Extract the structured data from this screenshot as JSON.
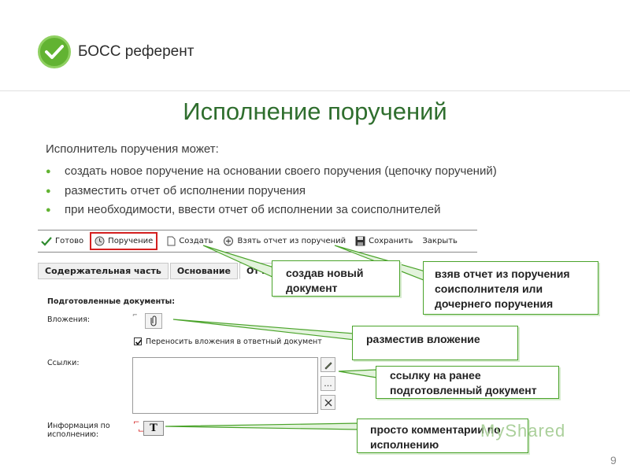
{
  "brand": {
    "name": "БОСС референт",
    "accent": "#62b332"
  },
  "slide": {
    "title": "Исполнение поручений",
    "intro": "Исполнитель поручения может:",
    "bullets": [
      "создать новое поручение на основании своего поручения (цепочку поручений)",
      "разместить отчет об исполнении поручения",
      "при необходимости, ввести отчет об исполнении за соисполнителей"
    ],
    "page_number": "9"
  },
  "toolbar": {
    "done": "Готово",
    "assignment": "Поручение",
    "create": "Создать",
    "take_report": "Взять отчет из поручений",
    "save": "Сохранить",
    "close": "Закрыть"
  },
  "tabs": [
    "Содержательная часть",
    "Основание",
    "Отче"
  ],
  "form": {
    "prepared_docs": "Подготовленные документы:",
    "attachments": "Вложения:",
    "transfer_checkbox": "Переносить вложения в ответный документ",
    "links": "Ссылки:",
    "exec_info_line1": "Информация по",
    "exec_info_line2": "исполнению:",
    "text_button": "T",
    "dots_button": "..."
  },
  "callouts": {
    "create_new": "создав новый документ",
    "take_report": "взяв отчет из поручения соисполнителя или дочернего поручения",
    "attachment": "разместив вложение",
    "link": "ссылку на ранее подготовленный документ",
    "comment": "просто комментарии по исполнению"
  },
  "watermark": "MyShared"
}
